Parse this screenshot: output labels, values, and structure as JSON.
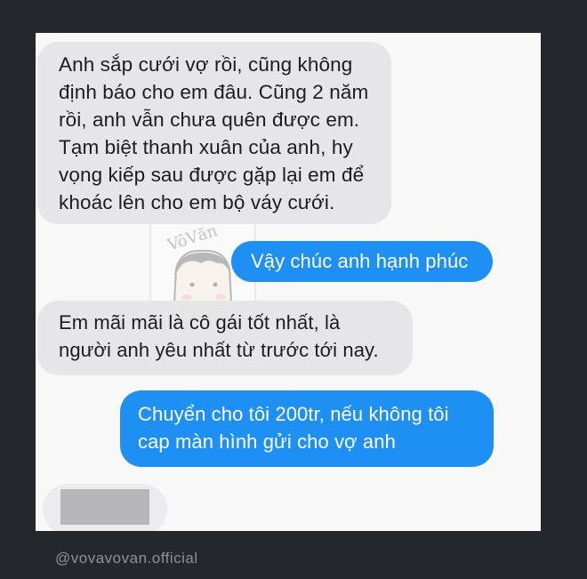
{
  "conversation": {
    "messages": [
      {
        "direction": "incoming",
        "text": "Anh sắp cưới vợ rồi, cũng không\nđịnh báo cho em đâu. Cũng 2 năm\nrồi, anh vẫn chưa quên được em.\nTạm biệt thanh xuân của anh, hy\nvọng kiếp sau được gặp lại em để\nkhoác lên cho em bộ váy cưới."
      },
      {
        "direction": "outgoing",
        "text": "Vậy chúc anh hạnh phúc"
      },
      {
        "direction": "incoming",
        "text": "Em mãi mãi là cô gái tốt nhất, là\nngười anh yêu nhất từ trước tới nay."
      },
      {
        "direction": "outgoing",
        "text": "Chuyển cho tôi 200tr, nếu không tôi\ncap màn hình gửi cho vợ anh"
      }
    ]
  },
  "watermark": {
    "sticker_text": "VôVăn",
    "credit": "@vovavovan.official"
  },
  "colors": {
    "incoming_bubble": "#e6e6e8",
    "outgoing_bubble": "#1e8ff3",
    "background": "#f8f8f8"
  }
}
